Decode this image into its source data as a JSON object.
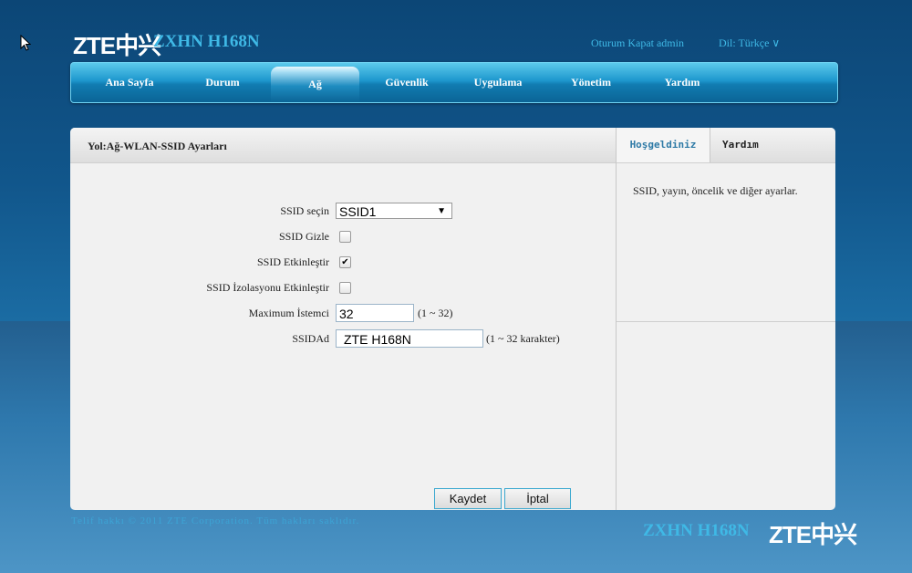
{
  "brand": {
    "logo": "ZTE中兴",
    "model": "ZXHN H168N"
  },
  "top_links": {
    "logout": "Oturum Kapat  admin",
    "language": "Dil: Türkçe  ∨"
  },
  "nav": {
    "items": [
      "Ana Sayfa",
      "Durum",
      "Ağ",
      "Güvenlik",
      "Uygulama",
      "Yönetim",
      "Yardım"
    ],
    "active": "Ağ"
  },
  "panel": {
    "breadcrumb": "Yol:Ağ-WLAN-SSID Ayarları"
  },
  "side": {
    "tabs": [
      "Hoşgeldiniz",
      "Yardım"
    ],
    "active_tab": "Hoşgeldiniz",
    "text": "SSID, yayın, öncelik ve diğer ayarlar."
  },
  "form": {
    "ssid_select_label": "SSID seçin",
    "ssid_select_value": "SSID1",
    "ssid_hide_label": "SSID Gizle",
    "ssid_hide_checked": false,
    "ssid_enable_label": "SSID Etkinleştir",
    "ssid_enable_checked": true,
    "ssid_isolation_label": "SSID İzolasyonu Etkinleştir",
    "ssid_isolation_checked": false,
    "max_clients_label": "Maximum İstemci",
    "max_clients_value": "32",
    "max_clients_hint": "(1 ~ 32)",
    "ssid_name_label": "SSIDAd",
    "ssid_name_value": "ZTE H168N",
    "ssid_name_hint": "(1 ~ 32 karakter)"
  },
  "buttons": {
    "save": "Kaydet",
    "cancel": "İptal"
  },
  "footer": {
    "copyright": "Telif hakkı © 2011 ZTE Corporation. Tüm hakları saklıdır.",
    "model": "ZXHN H168N",
    "logo": "ZTE中兴"
  },
  "colors": {
    "accent": "#3fb9e6",
    "nav": "#1d97cd",
    "panel": "#f1f1f1"
  },
  "icons": {
    "cursor": "mouse-pointer-icon",
    "check": "checkmark-icon",
    "dropdown": "chevron-down-icon"
  }
}
